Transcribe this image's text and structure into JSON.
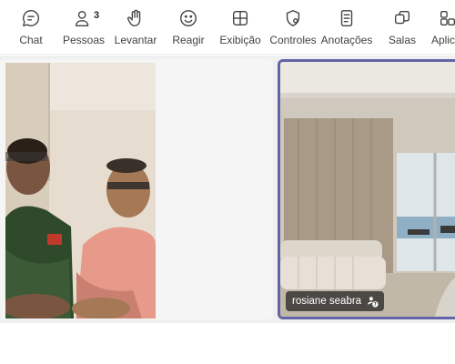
{
  "toolbar": {
    "chat": "Chat",
    "people": "Pessoas",
    "people_count": "3",
    "raise": "Levantar",
    "react": "Reagir",
    "view": "Exibição",
    "controls": "Controles",
    "notes": "Anotações",
    "rooms": "Salas",
    "apps": "Aplic"
  },
  "participants": {
    "left_tile": "",
    "right_tile": {
      "name": "rosiane seabra"
    }
  },
  "colors": {
    "accent": "#6264a7",
    "name_chip_bg": "#1e1e1e"
  }
}
